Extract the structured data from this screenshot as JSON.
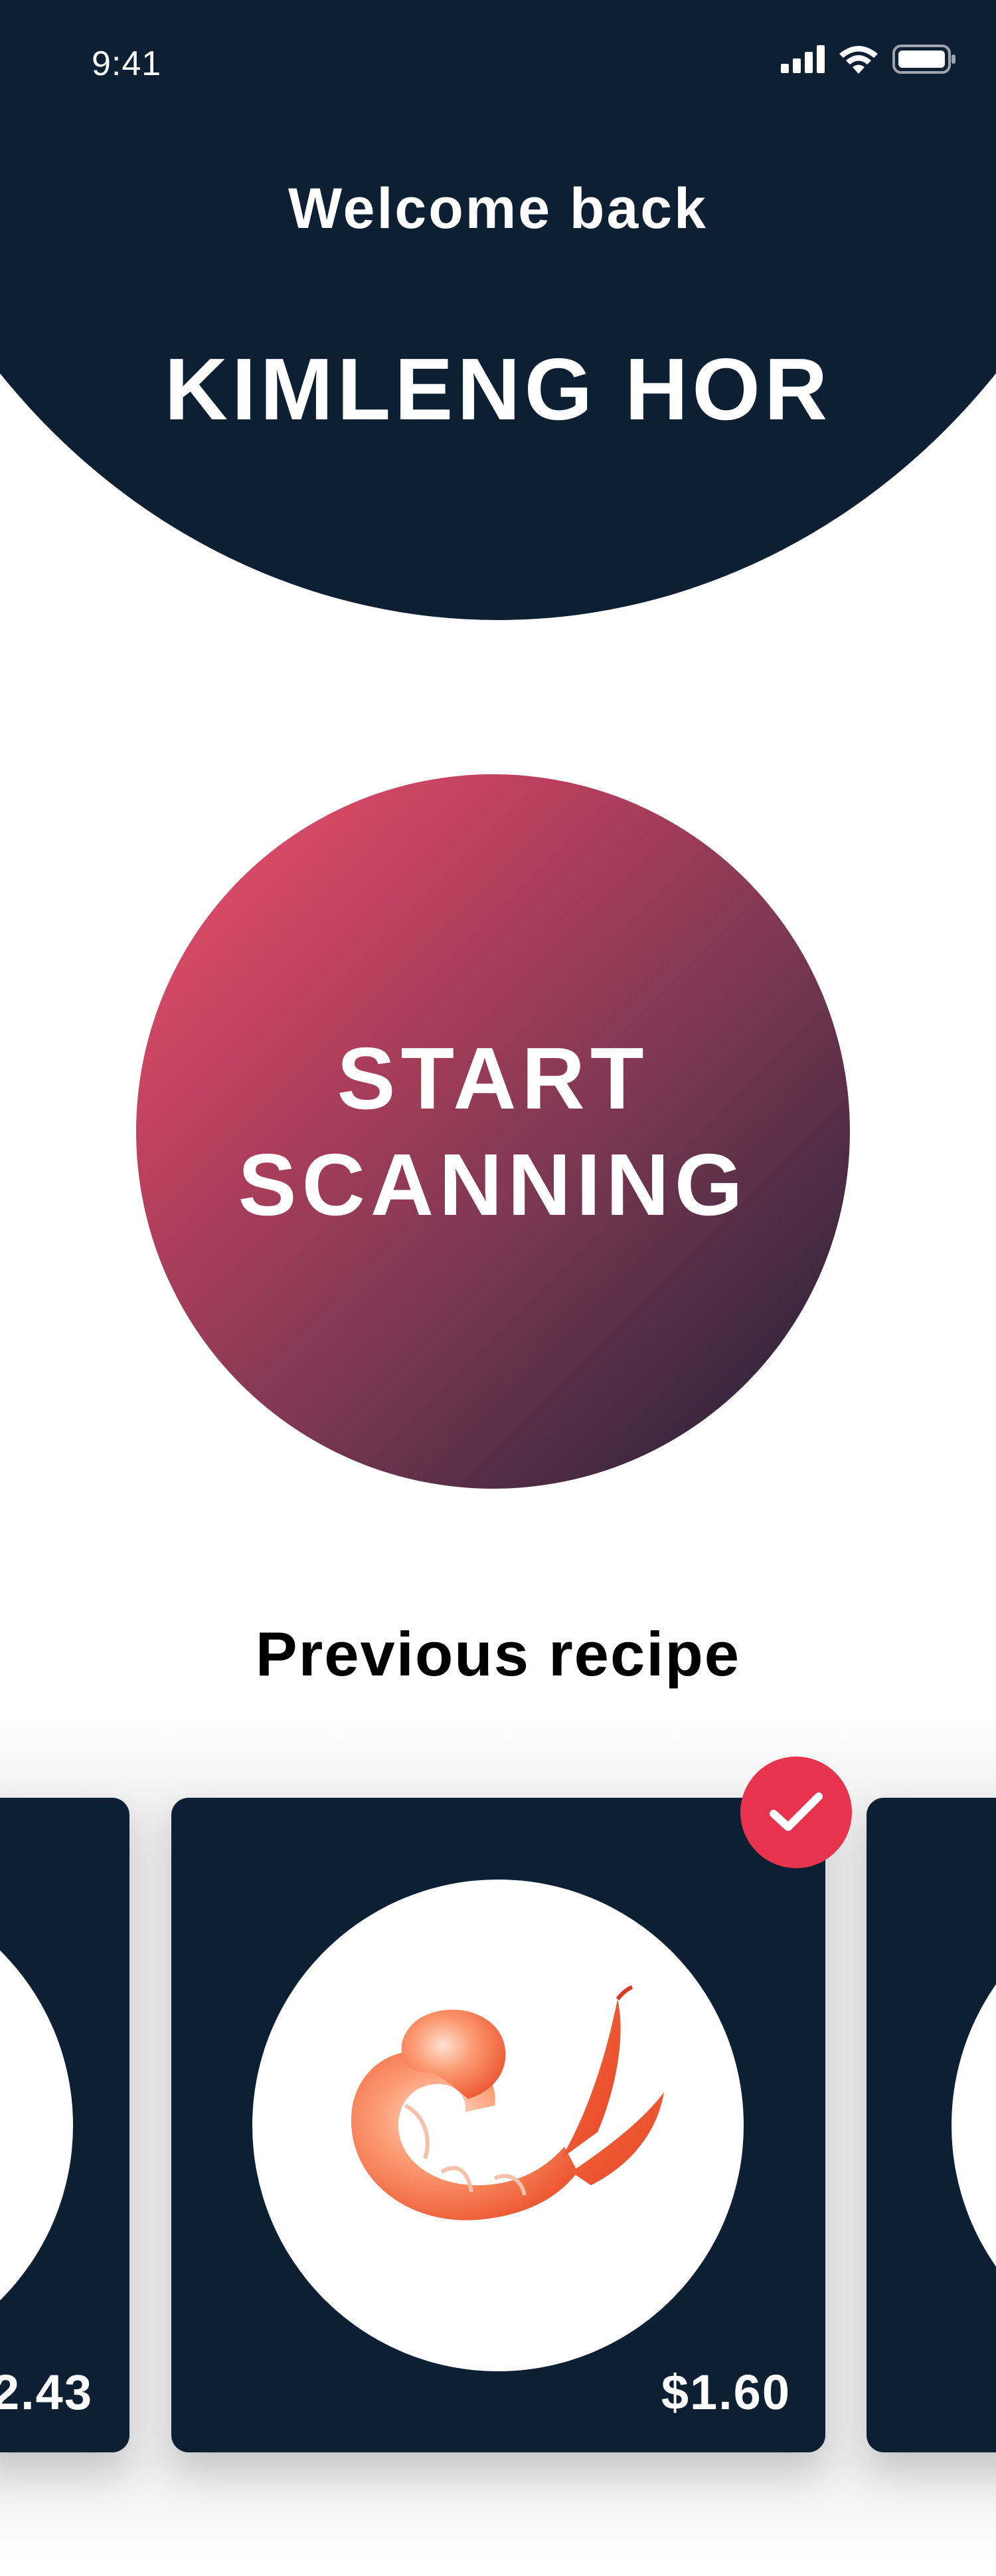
{
  "status_bar": {
    "time": "9:41",
    "icons": [
      "cellular-signal-icon",
      "wifi-icon",
      "battery-icon"
    ]
  },
  "header": {
    "welcome": "Welcome back",
    "username": "KIMLENG HOR"
  },
  "scan_button": {
    "line1": "START",
    "line2": "SCANNING"
  },
  "previous_recipe": {
    "title": "Previous recipe",
    "cards": [
      {
        "price": "2.43",
        "selected": false
      },
      {
        "price": "$1.60",
        "selected": true,
        "image": "shrimp"
      },
      {
        "price": "",
        "selected": false
      }
    ]
  },
  "colors": {
    "navy": "#0d1f33",
    "accent": "#e8334f",
    "gradient_start": "#f2526f",
    "gradient_end": "#1a1f33"
  }
}
